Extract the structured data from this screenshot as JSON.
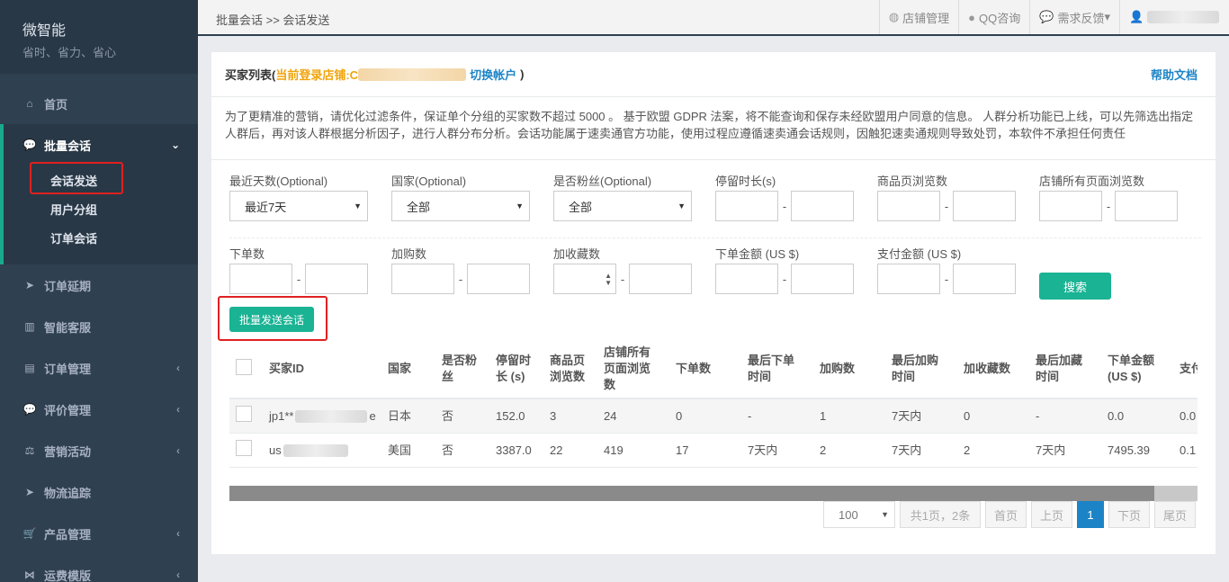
{
  "app": {
    "name": "微智能",
    "slogan": "省时、省力、省心"
  },
  "sidebar": {
    "items": [
      {
        "label": "首页",
        "icon": "home-icon"
      },
      {
        "label": "批量会话",
        "icon": "chat-icon",
        "active": true,
        "children": [
          {
            "label": "会话发送"
          },
          {
            "label": "用户分组"
          },
          {
            "label": "订单会话"
          }
        ]
      },
      {
        "label": "订单延期",
        "icon": "send-icon"
      },
      {
        "label": "智能客服",
        "icon": "chart-icon"
      },
      {
        "label": "订单管理",
        "icon": "document-icon"
      },
      {
        "label": "评价管理",
        "icon": "comment-icon"
      },
      {
        "label": "营销活动",
        "icon": "scale-icon"
      },
      {
        "label": "物流追踪",
        "icon": "send-icon"
      },
      {
        "label": "产品管理",
        "icon": "cart-icon"
      },
      {
        "label": "运费模版",
        "icon": "share-icon"
      }
    ]
  },
  "topbar": {
    "breadcrumb": "批量会话 >> 会话发送",
    "links": [
      {
        "label": "店铺管理",
        "icon": "globe-icon"
      },
      {
        "label": "QQ咨询",
        "icon": "qq-icon"
      },
      {
        "label": "需求反馈",
        "icon": "chat-icon",
        "caret": "▾"
      }
    ]
  },
  "panel": {
    "title": "买家列表(",
    "store_label": "当前登录店铺:C",
    "switch_label": "切换帐户",
    "close_paren": ")",
    "help": "帮助文档",
    "notice": "为了更精准的营销，请优化过滤条件，保证单个分组的买家数不超过 5000 。 基于欧盟 GDPR 法案，将不能查询和保存未经欧盟用户同意的信息。 人群分析功能已上线，可以先筛选出指定人群后，再对该人群根据分析因子，进行人群分布分析。会话功能属于速卖通官方功能，使用过程应遵循速卖通会话规则，因触犯速卖通规则导致处罚，本软件不承担任何责任"
  },
  "filters": {
    "days_label": "最近天数(Optional)",
    "days_value": "最近7天",
    "country_label": "国家(Optional)",
    "country_value": "全部",
    "fan_label": "是否粉丝(Optional)",
    "fan_value": "全部",
    "stay_label": "停留时长(s)",
    "product_views_label": "商品页浏览数",
    "store_views_label": "店铺所有页面浏览数",
    "orders_label": "下单数",
    "cart_label": "加购数",
    "fav_label": "加收藏数",
    "order_amount_label": "下单金额 (US $)",
    "pay_amount_label": "支付金额 (US $)",
    "dash": "-",
    "search_button": "搜索"
  },
  "batch_button": "批量发送会话",
  "table": {
    "headers": [
      "买家ID",
      "国家",
      "是否粉丝",
      "停留时长 (s)",
      "商品页浏览数",
      "店铺所有页面浏览数",
      "下单数",
      "最后下单时间",
      "加购数",
      "最后加购时间",
      "加收藏数",
      "最后加藏时间",
      "下单金额 (US $)",
      "支付"
    ],
    "rows": [
      {
        "id_prefix": "jp1**",
        "id_suffix": "e",
        "country": "日本",
        "fan": "否",
        "stay": "152.0",
        "pviews": "3",
        "sviews": "24",
        "orders": "0",
        "last_order": "-",
        "cart": "1",
        "last_cart": "7天内",
        "fav": "0",
        "last_fav": "-",
        "amount": "0.0",
        "pay": "0.0"
      },
      {
        "id_prefix": "us",
        "id_suffix": "",
        "country": "美国",
        "fan": "否",
        "stay": "3387.0",
        "pviews": "22",
        "sviews": "419",
        "orders": "17",
        "last_order": "7天内",
        "cart": "2",
        "last_cart": "7天内",
        "fav": "2",
        "last_fav": "7天内",
        "amount": "7495.39",
        "pay": "0.1"
      }
    ]
  },
  "pager": {
    "page_size": "100",
    "info": "共1页，2条",
    "first": "首页",
    "prev": "上页",
    "current": "1",
    "next": "下页",
    "last": "尾页"
  },
  "colors": {
    "sidebar": "#2f4050",
    "accent": "#1ab394",
    "link": "#1c84c6",
    "highlight": "#e02020",
    "store": "#f0a40a"
  }
}
